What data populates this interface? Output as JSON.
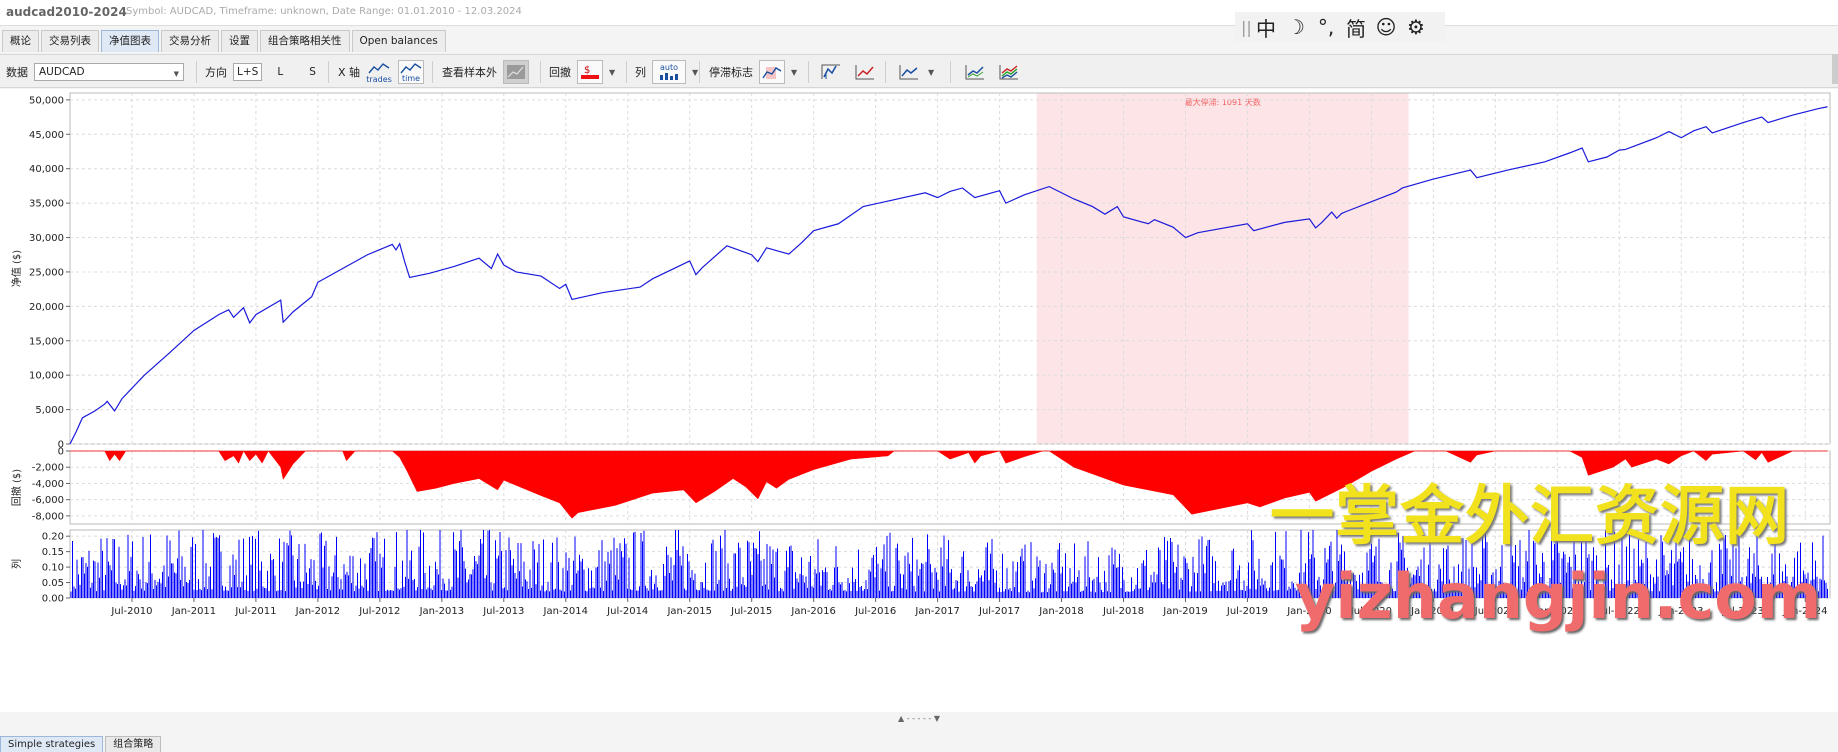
{
  "app": {
    "title": "audcad2010-2024",
    "info": "Symbol: AUDCAD, Timeframe: unknown, Date Range: 01.01.2010 - 12.03.2024"
  },
  "lang_bar": {
    "sep": "||",
    "items": [
      "中",
      "☽",
      "°,",
      "简",
      "☺",
      "⚙"
    ]
  },
  "tabs": [
    {
      "label": "概论"
    },
    {
      "label": "交易列表"
    },
    {
      "label": "净值图表",
      "active": true
    },
    {
      "label": "交易分析"
    },
    {
      "label": "设置"
    },
    {
      "label": "组合策略相关性"
    },
    {
      "label": "Open balances"
    }
  ],
  "toolbar": {
    "data_label": "数据",
    "data_value": "AUDCAD",
    "direction_label": "方向",
    "direction_options": [
      "L+S",
      "L",
      "S"
    ],
    "xaxis_label": "X 轴",
    "xaxis_trades": "trades",
    "xaxis_time": "time",
    "oos_label": "查看样本外",
    "drawdown_label": "回撤",
    "column_label": "列",
    "column_auto": "auto",
    "stagnation_label": "停滞标志"
  },
  "chart_data": [
    {
      "type": "line",
      "ylabel": "净值 ($)",
      "ylim": [
        0,
        51000
      ],
      "yticks": [
        0,
        5000,
        10000,
        15000,
        20000,
        25000,
        30000,
        35000,
        40000,
        45000,
        50000
      ],
      "ytick_labels": [
        "0",
        "5,000",
        "10,000",
        "15,000",
        "20,000",
        "25,000",
        "30,000",
        "35,000",
        "40,000",
        "45,000",
        "50,000"
      ],
      "xlim": [
        2010.0,
        2024.2
      ],
      "xticks": [
        2010.5,
        2011.0,
        2011.5,
        2012.0,
        2012.5,
        2013.0,
        2013.5,
        2014.0,
        2014.5,
        2015.0,
        2015.5,
        2016.0,
        2016.5,
        2017.0,
        2017.5,
        2018.0,
        2018.5,
        2019.0,
        2019.5,
        2020.0,
        2020.5,
        2021.0,
        2021.5,
        2022.0,
        2022.5,
        2023.0,
        2023.5,
        2024.0
      ],
      "xtick_labels": [
        "Jul-2010",
        "Jan-2011",
        "Jul-2011",
        "Jan-2012",
        "Jul-2012",
        "Jan-2013",
        "Jul-2013",
        "Jan-2014",
        "Jul-2014",
        "Jan-2015",
        "Jul-2015",
        "Jan-2016",
        "Jul-2016",
        "Jan-2017",
        "Jul-2017",
        "Jan-2018",
        "Jul-2018",
        "Jan-2019",
        "Jul-2019",
        "Jan-2020",
        "Jul-2020",
        "Jan-2021",
        "Jul-2021",
        "Jan-2022",
        "Jul-2022",
        "Jan-2023",
        "Jul-2023",
        "Jan-2024"
      ],
      "grid": true,
      "stagnation": {
        "x_start": 2017.8,
        "x_end": 2020.8,
        "label": "最大停滞: 1091 天数"
      },
      "series": [
        {
          "color": "#1a1adb",
          "x": [
            2010.0,
            2010.05,
            2010.1,
            2010.2,
            2010.28,
            2010.3,
            2010.36,
            2010.42,
            2010.6,
            2010.8,
            2011.0,
            2011.2,
            2011.28,
            2011.32,
            2011.4,
            2011.45,
            2011.5,
            2011.7,
            2011.72,
            2011.8,
            2011.95,
            2012.0,
            2012.2,
            2012.4,
            2012.6,
            2012.63,
            2012.66,
            2012.7,
            2012.74,
            2012.9,
            2013.1,
            2013.3,
            2013.4,
            2013.45,
            2013.5,
            2013.6,
            2013.8,
            2013.95,
            2014.0,
            2014.05,
            2014.3,
            2014.6,
            2014.7,
            2015.0,
            2015.05,
            2015.1,
            2015.3,
            2015.5,
            2015.55,
            2015.62,
            2015.8,
            2015.9,
            2016.0,
            2016.2,
            2016.4,
            2016.6,
            2016.7,
            2016.9,
            2017.0,
            2017.1,
            2017.2,
            2017.3,
            2017.5,
            2017.55,
            2017.7,
            2017.9,
            2018.1,
            2018.25,
            2018.35,
            2018.45,
            2018.5,
            2018.7,
            2018.75,
            2018.9,
            2019.0,
            2019.1,
            2019.5,
            2019.55,
            2019.8,
            2020.0,
            2020.05,
            2020.1,
            2020.18,
            2020.22,
            2020.26,
            2020.3,
            2020.5,
            2020.7,
            2020.75,
            2021.0,
            2021.3,
            2021.35,
            2021.6,
            2021.9,
            2022.1,
            2022.2,
            2022.25,
            2022.4,
            2022.5,
            2022.55,
            2022.8,
            2022.9,
            2023.0,
            2023.1,
            2023.2,
            2023.25,
            2023.5,
            2023.65,
            2023.7,
            2023.9,
            2024.1,
            2024.18
          ],
          "y": [
            0,
            1800,
            3800,
            4800,
            5800,
            6200,
            4800,
            6600,
            10000,
            13200,
            16500,
            18800,
            19500,
            18400,
            19800,
            17600,
            18800,
            20900,
            17700,
            19200,
            21400,
            23500,
            25500,
            27500,
            29000,
            28200,
            29100,
            26500,
            24200,
            24800,
            25800,
            27000,
            25500,
            27600,
            26000,
            25000,
            24400,
            22600,
            23200,
            21000,
            22000,
            22800,
            24000,
            26600,
            24600,
            25600,
            28800,
            27500,
            26500,
            28500,
            27600,
            29200,
            31000,
            32000,
            34500,
            35300,
            35700,
            36500,
            35800,
            36700,
            37200,
            35800,
            36800,
            35000,
            36200,
            37400,
            35600,
            34500,
            33400,
            34500,
            33000,
            32000,
            32600,
            31500,
            30000,
            30700,
            32000,
            31000,
            32200,
            32700,
            31400,
            32200,
            33700,
            32800,
            33500,
            33800,
            35200,
            36600,
            37200,
            38500,
            39800,
            38700,
            39800,
            41000,
            42300,
            43000,
            41000,
            41700,
            42700,
            42800,
            44500,
            45400,
            44500,
            45500,
            46100,
            45200,
            46700,
            47500,
            46700,
            47800,
            48700,
            49000
          ]
        }
      ]
    },
    {
      "type": "area",
      "ylabel": "回撤 ($)",
      "ylim": [
        -9000,
        0
      ],
      "yticks": [
        0,
        -2000,
        -4000,
        -6000,
        -8000
      ],
      "ytick_labels": [
        "0",
        "-2,000",
        "-4,000",
        "-6,000",
        "-8,000"
      ],
      "series": [
        {
          "color": "#ff0000",
          "x": [
            2010.0,
            2010.28,
            2010.32,
            2010.36,
            2010.4,
            2010.45,
            2011.2,
            2011.25,
            2011.32,
            2011.36,
            2011.4,
            2011.45,
            2011.5,
            2011.55,
            2011.6,
            2011.7,
            2011.72,
            2011.8,
            2011.9,
            2012.0,
            2012.2,
            2012.23,
            2012.3,
            2012.6,
            2012.66,
            2012.72,
            2012.8,
            2012.95,
            2013.1,
            2013.3,
            2013.45,
            2013.5,
            2013.8,
            2013.95,
            2014.05,
            2014.1,
            2014.4,
            2014.7,
            2014.95,
            2015.05,
            2015.2,
            2015.35,
            2015.45,
            2015.55,
            2015.62,
            2015.7,
            2015.8,
            2016.0,
            2016.3,
            2016.6,
            2016.65,
            2017.0,
            2017.1,
            2017.25,
            2017.3,
            2017.35,
            2017.5,
            2017.55,
            2017.7,
            2017.85,
            2017.9,
            2018.1,
            2018.5,
            2018.9,
            2019.05,
            2019.5,
            2019.6,
            2019.8,
            2020.0,
            2020.05,
            2020.3,
            2020.5,
            2020.7,
            2020.85,
            2021.1,
            2021.3,
            2021.35,
            2021.5,
            2021.6,
            2022.1,
            2022.2,
            2022.25,
            2022.45,
            2022.55,
            2022.6,
            2022.8,
            2022.9,
            2023.0,
            2023.1,
            2023.2,
            2023.25,
            2023.5,
            2023.6,
            2023.65,
            2023.7,
            2023.9,
            2024.18
          ],
          "y": [
            0,
            0,
            -1200,
            -400,
            -1200,
            0,
            0,
            -1200,
            -600,
            -1500,
            0,
            -1200,
            -400,
            -1500,
            0,
            -2000,
            -3500,
            -1600,
            0,
            0,
            0,
            -1200,
            0,
            0,
            -800,
            -2500,
            -5000,
            -4600,
            -4000,
            -3400,
            -4800,
            -3600,
            -5500,
            -6400,
            -8300,
            -7600,
            -6700,
            -5200,
            -4800,
            -6400,
            -5000,
            -3400,
            -4400,
            -5900,
            -3800,
            -4600,
            -3500,
            -2300,
            -1000,
            -600,
            0,
            0,
            -1000,
            -200,
            -1500,
            -600,
            0,
            -1500,
            -700,
            0,
            0,
            -2000,
            -4200,
            -5400,
            -7800,
            -6400,
            -6900,
            -5800,
            -5100,
            -6200,
            -4300,
            -2500,
            -1000,
            0,
            0,
            -1400,
            -500,
            0,
            0,
            0,
            -800,
            -3000,
            -2000,
            -1000,
            -2000,
            -1000,
            -1600,
            -600,
            0,
            -1200,
            -400,
            0,
            -1100,
            -200,
            -1400,
            0,
            0
          ]
        }
      ]
    },
    {
      "type": "bar",
      "ylabel": "列",
      "ylim": [
        0,
        0.22
      ],
      "yticks": [
        0,
        0.05,
        0.1,
        0.15,
        0.2
      ],
      "ytick_labels": [
        "0.00",
        "0.05",
        "0.10",
        "0.15",
        "0.20"
      ],
      "series": [
        {
          "color": "#0000ff",
          "x": [
            2010.0,
            2011.0,
            2012.0,
            2013.0,
            2014.0,
            2015.0,
            2016.0,
            2017.0,
            2018.0,
            2019.0,
            2020.0,
            2021.0,
            2022.0,
            2023.0,
            2024.0
          ],
          "y": [
            0.06,
            0.07,
            0.06,
            0.07,
            0.06,
            0.07,
            0.06,
            0.06,
            0.05,
            0.06,
            0.07,
            0.06,
            0.07,
            0.06,
            0.06
          ]
        }
      ]
    }
  ],
  "bottom_strip": "▲ - - - - - ▼",
  "bottom_tabs": [
    {
      "label": "Simple strategies",
      "active": true
    },
    {
      "label": "组合策略"
    }
  ],
  "watermark": {
    "line1": "一掌金外汇资源网",
    "line2": "yizhangjin.com"
  }
}
